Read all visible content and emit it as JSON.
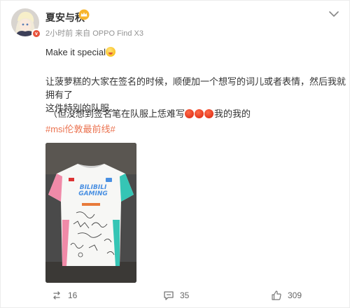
{
  "author": {
    "name": "夏安与秋",
    "time": "2小时前",
    "source_prefix": "来自",
    "source": "OPPO Find X3"
  },
  "post": {
    "line1": "Make it special",
    "para1_line1": "让菠萝糕的大家在签名的时候，顺便加一个想写的词儿或者表情，然后我就拥有了",
    "para1_line2": "这件特别的队服。",
    "para2_prefix": "（但没想到签名笔在队服上恁难写",
    "para2_suffix": "我的我的",
    "hashtag": "#msi伦敦最前线#"
  },
  "jersey": {
    "line1": "BILIBILI",
    "line2": "GAMING"
  },
  "actions": {
    "repost_count": "16",
    "comment_count": "35",
    "like_count": "309"
  },
  "colors": {
    "hashtag": "#eb7350",
    "jersey_blue": "#4a90e2",
    "jersey_pink": "#f08aa8",
    "jersey_teal": "#35c5b5"
  },
  "icons": [
    "more-chevron-icon",
    "crown-badge-icon",
    "repost-icon",
    "comment-icon",
    "like-icon"
  ]
}
